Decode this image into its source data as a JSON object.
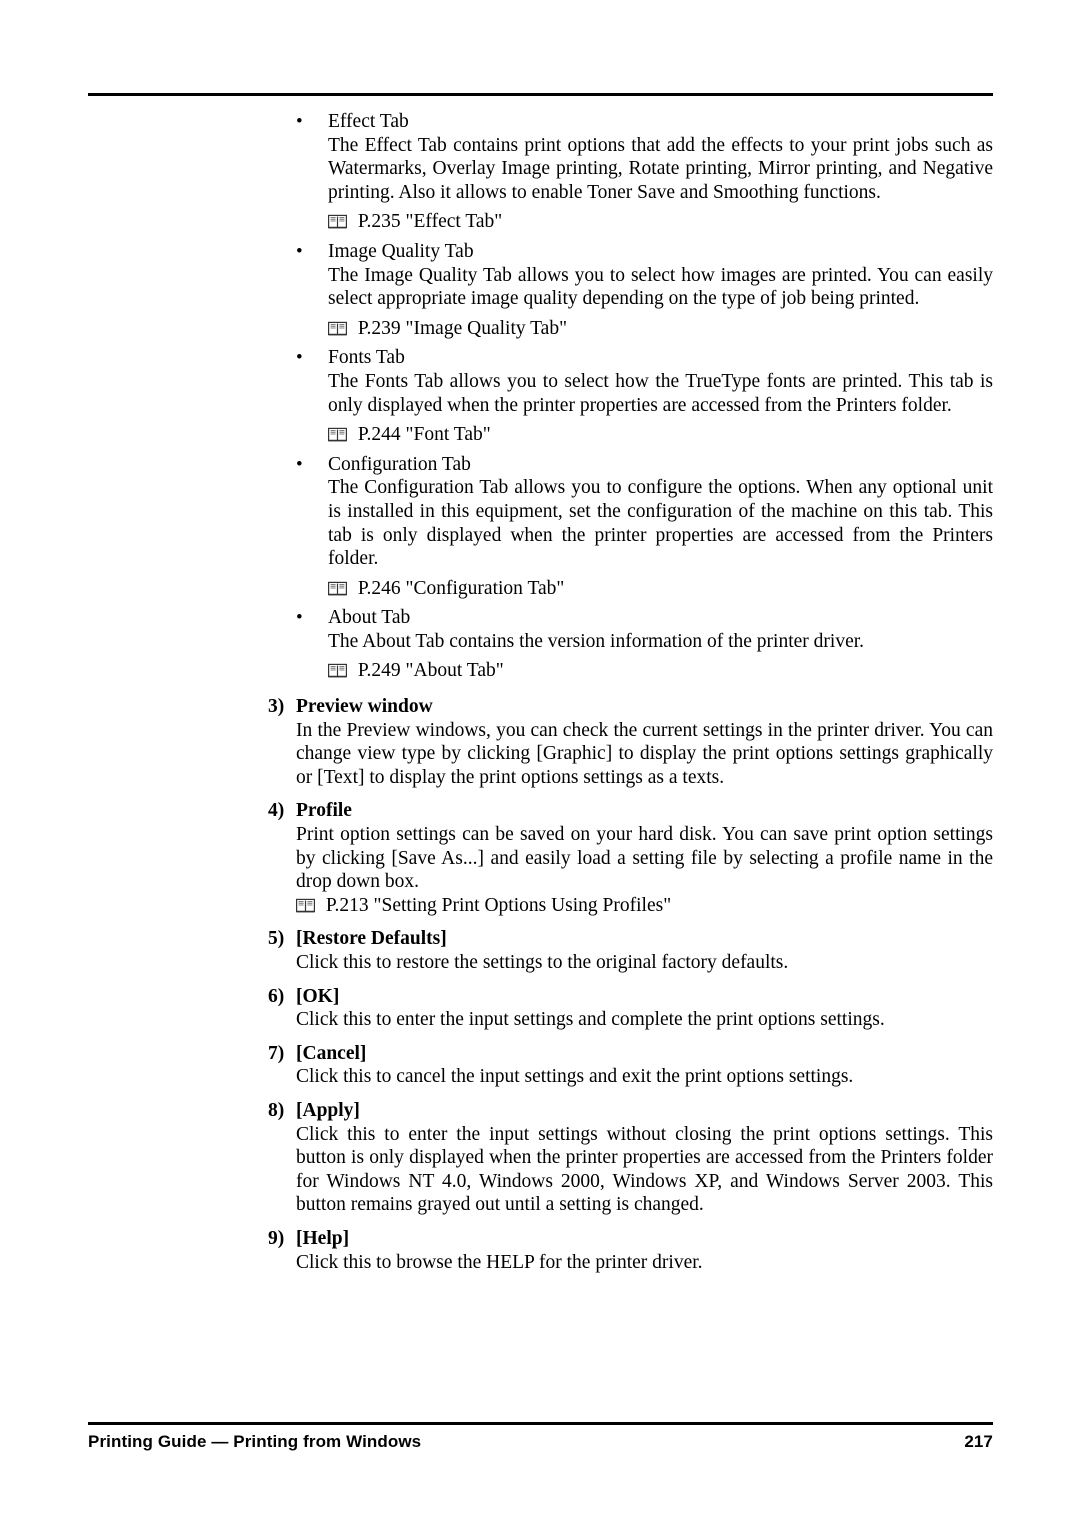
{
  "page": {
    "number": "217",
    "footer_left": "Printing Guide — Printing from Windows"
  },
  "icons": {
    "book": "book-reference-icon",
    "bullet": "•"
  },
  "bullets": [
    {
      "title": "Effect Tab",
      "body": "The Effect Tab contains print options that add the effects to your print jobs such as Watermarks, Overlay Image printing, Rotate printing, Mirror printing, and Negative printing.  Also it allows to enable Toner Save and Smoothing functions.",
      "reference": "P.235 \"Effect Tab\""
    },
    {
      "title": "Image Quality Tab",
      "body": "The Image Quality Tab allows you to select how images are printed.  You can easily select appropriate image quality depending on the type of job being printed.",
      "reference": "P.239 \"Image Quality Tab\""
    },
    {
      "title": "Fonts Tab",
      "body": "The Fonts Tab allows you to select how the TrueType fonts are printed.  This tab is only displayed when the printer properties are accessed from the Printers folder.",
      "reference": "P.244 \"Font Tab\""
    },
    {
      "title": "Configuration Tab",
      "body": "The Configuration Tab allows you to configure the options.  When any optional unit is installed in this equipment, set the configuration of the machine on this tab.  This tab is only displayed when the printer properties are accessed from the Printers folder.",
      "reference": "P.246 \"Configuration Tab\""
    },
    {
      "title": "About Tab",
      "body": "The About Tab contains the version information of the printer driver.",
      "reference": "P.249 \"About Tab\""
    }
  ],
  "sections": [
    {
      "num": "3)",
      "heading": "Preview window",
      "body": "In the Preview windows, you can check the current settings in the printer driver.  You can change view type by clicking [Graphic] to display the print options settings graphically or [Text] to display the print options settings as a texts.",
      "reference": ""
    },
    {
      "num": "4)",
      "heading": "Profile",
      "body": "Print option settings can be saved on your hard disk. You can save print option settings by clicking [Save As...] and easily load a setting file by selecting a profile name in the drop down box.",
      "reference": "P.213 \"Setting Print Options Using Profiles\""
    },
    {
      "num": "5)",
      "heading": "[Restore Defaults]",
      "body": "Click this to restore the settings to the original factory defaults.",
      "reference": ""
    },
    {
      "num": "6)",
      "heading": "[OK]",
      "body": "Click this to enter the input settings and complete the print options settings.",
      "reference": ""
    },
    {
      "num": "7)",
      "heading": "[Cancel]",
      "body": "Click this to cancel the input settings and exit the print options settings.",
      "reference": ""
    },
    {
      "num": "8)",
      "heading": "[Apply]",
      "body": "Click this to enter the input settings without closing the print options settings.  This button is only displayed when the printer properties are accessed from the Printers folder for Windows NT 4.0, Windows 2000, Windows XP, and Windows Server 2003.  This button remains grayed out until a setting is changed.",
      "reference": ""
    },
    {
      "num": "9)",
      "heading": "[Help]",
      "body": "Click this to browse the HELP for the printer driver.",
      "reference": ""
    }
  ]
}
